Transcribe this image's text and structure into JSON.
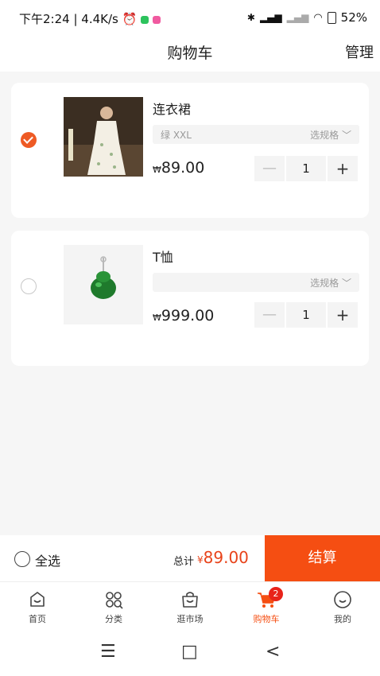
{
  "status_bar": {
    "time": "下午2:24",
    "speed": "4.4K/s",
    "battery": "52%"
  },
  "header": {
    "title": "购物车",
    "manage": "管理"
  },
  "items": [
    {
      "name": "连衣裙",
      "spec_value": "绿 XXL",
      "spec_select": "选规格",
      "price_prefix": "₩",
      "price": "89.00",
      "quantity": "1",
      "checked": true
    },
    {
      "name": "T恤",
      "spec_value": "",
      "spec_select": "选规格",
      "price_prefix": "₩",
      "price": "999.00",
      "quantity": "1",
      "checked": false
    }
  ],
  "checkout": {
    "select_all": "全选",
    "total_label": "总计",
    "currency": "¥",
    "total": "89.00",
    "settle": "结算"
  },
  "tabs": [
    {
      "label": "首页",
      "icon": "home-icon"
    },
    {
      "label": "分类",
      "icon": "category-icon"
    },
    {
      "label": "逛市场",
      "icon": "market-icon"
    },
    {
      "label": "购物车",
      "icon": "cart-icon",
      "badge": "2",
      "active": true
    },
    {
      "label": "我的",
      "icon": "profile-icon"
    }
  ],
  "nav": {
    "menu": "☰",
    "home": "□",
    "back": "<"
  },
  "colors": {
    "accent": "#f54e12",
    "price_red": "#e8431a",
    "check": "#ee5a24"
  }
}
